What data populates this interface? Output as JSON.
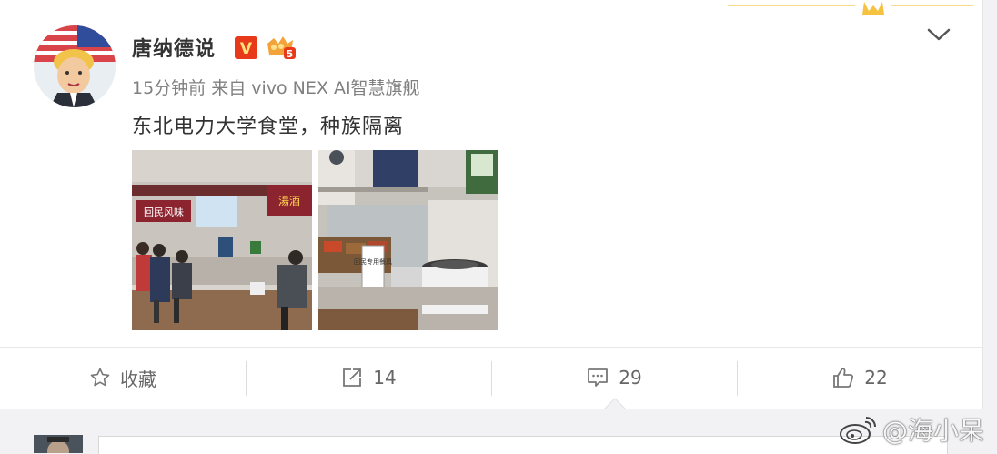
{
  "post": {
    "username": "唐纳德说",
    "meta": "15分钟前 来自 vivo NEX AI智慧旗舰",
    "text": "东北电力大学食堂，种族隔离",
    "badges": {
      "verified": "V",
      "level": "5"
    },
    "photos": [
      {
        "sign_left": "回民风味",
        "sign_right": "湯酒"
      },
      {
        "card": "回民专用餐具"
      }
    ]
  },
  "actions": {
    "favorite_label": "收藏",
    "share_count": "14",
    "comment_count": "29",
    "like_count": "22"
  },
  "watermark": {
    "text": "@海小呆"
  },
  "colors": {
    "verified_badge": "#e8391a",
    "level_badge": "#f2a33a",
    "text_primary": "#333333",
    "text_meta": "#808080",
    "action_text": "#666666",
    "top_accent": "#f5c242"
  }
}
